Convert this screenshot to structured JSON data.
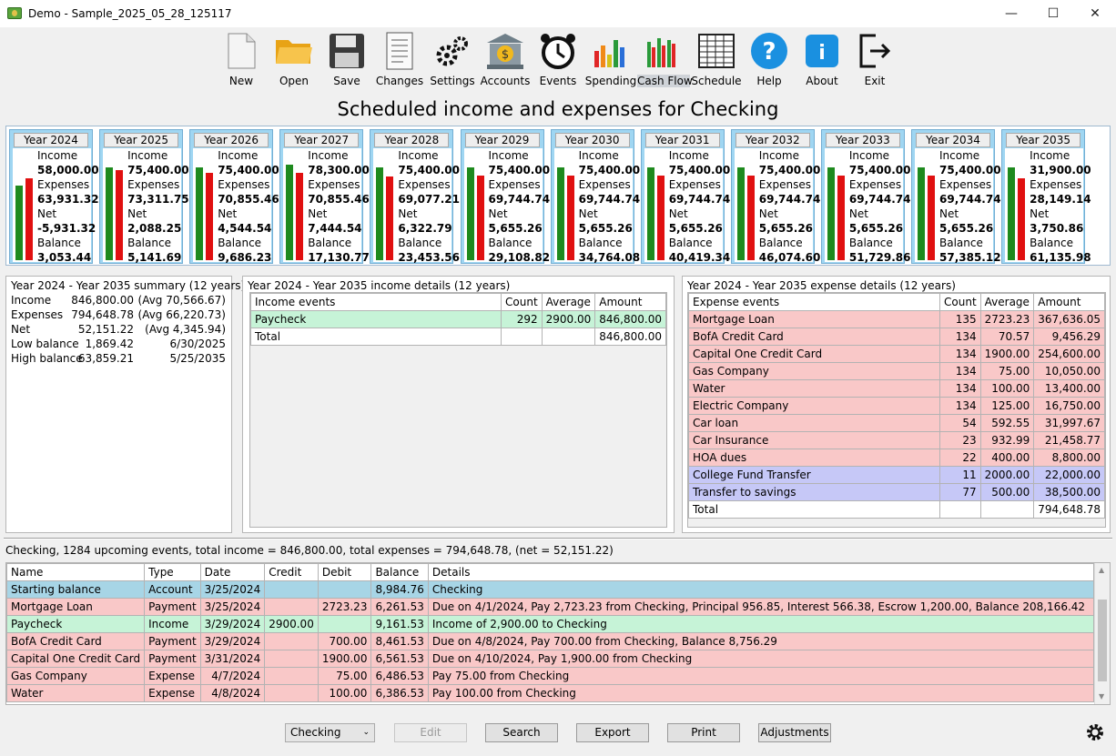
{
  "window": {
    "title": "Demo - Sample_2025_05_28_125117",
    "minimize": "—",
    "maximize": "☐",
    "close": "✕"
  },
  "toolbar": [
    {
      "label": "New",
      "icon": "new-file-icon"
    },
    {
      "label": "Open",
      "icon": "folder-open-icon"
    },
    {
      "label": "Save",
      "icon": "floppy-disk-icon"
    },
    {
      "label": "Changes",
      "icon": "document-changes-icon"
    },
    {
      "label": "Settings",
      "icon": "gears-icon"
    },
    {
      "label": "Accounts",
      "icon": "bank-icon"
    },
    {
      "label": "Events",
      "icon": "alarm-clock-icon"
    },
    {
      "label": "Spending",
      "icon": "bar-chart-icon"
    },
    {
      "label": "Cash Flow",
      "icon": "cash-flow-chart-icon"
    },
    {
      "label": "Schedule",
      "icon": "calendar-grid-icon"
    },
    {
      "label": "Help",
      "icon": "help-icon"
    },
    {
      "label": "About",
      "icon": "info-icon"
    },
    {
      "label": "Exit",
      "icon": "exit-icon"
    }
  ],
  "heading": "Scheduled income and expenses for Checking",
  "year_labels": {
    "income": "Income",
    "expenses": "Expenses",
    "net": "Net",
    "balance": "Balance"
  },
  "years": [
    {
      "year": "Year 2024",
      "income": "58,000.00",
      "expenses": "63,931.32",
      "net": "-5,931.32",
      "balance": "3,053.44",
      "income_fraction": 0.78,
      "expense_fraction": 0.86
    },
    {
      "year": "Year 2025",
      "income": "75,400.00",
      "expenses": "73,311.75",
      "net": "2,088.25",
      "balance": "5,141.69",
      "income_fraction": 0.97,
      "expense_fraction": 0.94
    },
    {
      "year": "Year 2026",
      "income": "75,400.00",
      "expenses": "70,855.46",
      "net": "4,544.54",
      "balance": "9,686.23",
      "income_fraction": 0.97,
      "expense_fraction": 0.91
    },
    {
      "year": "Year 2027",
      "income": "78,300.00",
      "expenses": "70,855.46",
      "net": "7,444.54",
      "balance": "17,130.77",
      "income_fraction": 1.0,
      "expense_fraction": 0.91
    },
    {
      "year": "Year 2028",
      "income": "75,400.00",
      "expenses": "69,077.21",
      "net": "6,322.79",
      "balance": "23,453.56",
      "income_fraction": 0.97,
      "expense_fraction": 0.88
    },
    {
      "year": "Year 2029",
      "income": "75,400.00",
      "expenses": "69,744.74",
      "net": "5,655.26",
      "balance": "29,108.82",
      "income_fraction": 0.97,
      "expense_fraction": 0.89
    },
    {
      "year": "Year 2030",
      "income": "75,400.00",
      "expenses": "69,744.74",
      "net": "5,655.26",
      "balance": "34,764.08",
      "income_fraction": 0.97,
      "expense_fraction": 0.89
    },
    {
      "year": "Year 2031",
      "income": "75,400.00",
      "expenses": "69,744.74",
      "net": "5,655.26",
      "balance": "40,419.34",
      "income_fraction": 0.97,
      "expense_fraction": 0.89
    },
    {
      "year": "Year 2032",
      "income": "75,400.00",
      "expenses": "69,744.74",
      "net": "5,655.26",
      "balance": "46,074.60",
      "income_fraction": 0.97,
      "expense_fraction": 0.89
    },
    {
      "year": "Year 2033",
      "income": "75,400.00",
      "expenses": "69,744.74",
      "net": "5,655.26",
      "balance": "51,729.86",
      "income_fraction": 0.97,
      "expense_fraction": 0.89
    },
    {
      "year": "Year 2034",
      "income": "75,400.00",
      "expenses": "69,744.74",
      "net": "5,655.26",
      "balance": "57,385.12",
      "income_fraction": 0.97,
      "expense_fraction": 0.89
    },
    {
      "year": "Year 2035",
      "income": "31,900.00",
      "expenses": "28,149.14",
      "net": "3,750.86",
      "balance": "61,135.98",
      "income_fraction": 0.97,
      "expense_fraction": 0.86
    }
  ],
  "summary": {
    "title": "Year 2024 - Year 2035 summary (12 years)",
    "rows": [
      {
        "label": "Income",
        "value": "846,800.00",
        "extra": "(Avg 70,566.67)"
      },
      {
        "label": "Expenses",
        "value": "794,648.78",
        "extra": "(Avg 66,220.73)"
      },
      {
        "label": "Net",
        "value": "52,151.22",
        "extra": "(Avg 4,345.94)"
      },
      {
        "label": "Low balance",
        "value": "1,869.42",
        "extra": "6/30/2025"
      },
      {
        "label": "High balance",
        "value": "63,859.21",
        "extra": "5/25/2035"
      }
    ]
  },
  "income_details": {
    "title": "Year 2024 - Year 2035 income details (12 years)",
    "headers": [
      "Income events",
      "Count",
      "Average",
      "Amount"
    ],
    "rows": [
      {
        "name": "Paycheck",
        "count": "292",
        "avg": "2900.00",
        "amount": "846,800.00"
      }
    ],
    "total_label": "Total",
    "total": "846,800.00"
  },
  "expense_details": {
    "title": "Year 2024 - Year 2035 expense details (12 years)",
    "headers": [
      "Expense events",
      "Count",
      "Average",
      "Amount"
    ],
    "rows": [
      {
        "name": "Mortgage Loan",
        "count": "135",
        "avg": "2723.23",
        "amount": "367,636.05",
        "kind": "pink"
      },
      {
        "name": "BofA Credit Card",
        "count": "134",
        "avg": "70.57",
        "amount": "9,456.29",
        "kind": "pink"
      },
      {
        "name": "Capital One Credit Card",
        "count": "134",
        "avg": "1900.00",
        "amount": "254,600.00",
        "kind": "pink"
      },
      {
        "name": "Gas Company",
        "count": "134",
        "avg": "75.00",
        "amount": "10,050.00",
        "kind": "pink"
      },
      {
        "name": "Water",
        "count": "134",
        "avg": "100.00",
        "amount": "13,400.00",
        "kind": "pink"
      },
      {
        "name": "Electric Company",
        "count": "134",
        "avg": "125.00",
        "amount": "16,750.00",
        "kind": "pink"
      },
      {
        "name": "Car loan",
        "count": "54",
        "avg": "592.55",
        "amount": "31,997.67",
        "kind": "pink"
      },
      {
        "name": "Car Insurance",
        "count": "23",
        "avg": "932.99",
        "amount": "21,458.77",
        "kind": "pink"
      },
      {
        "name": "HOA dues",
        "count": "22",
        "avg": "400.00",
        "amount": "8,800.00",
        "kind": "pink"
      },
      {
        "name": "College Fund Transfer",
        "count": "11",
        "avg": "2000.00",
        "amount": "22,000.00",
        "kind": "blue"
      },
      {
        "name": "Transfer to savings",
        "count": "77",
        "avg": "500.00",
        "amount": "38,500.00",
        "kind": "blue"
      }
    ],
    "total_label": "Total",
    "total": "794,648.78"
  },
  "status": "Checking, 1284 upcoming events, total income = 846,800.00, total expenses = 794,648.78, (net = 52,151.22)",
  "events": {
    "headers": [
      "Name",
      "Type",
      "Date",
      "Credit",
      "Debit",
      "Balance",
      "Details"
    ],
    "rows": [
      {
        "name": "Starting balance",
        "type": "Account",
        "date": "3/25/2024",
        "credit": "",
        "debit": "",
        "balance": "8,984.76",
        "details": "Checking",
        "kind": "acct"
      },
      {
        "name": "Mortgage Loan",
        "type": "Payment",
        "date": "3/25/2024",
        "credit": "",
        "debit": "2723.23",
        "balance": "6,261.53",
        "details": "Due on 4/1/2024, Pay 2,723.23 from Checking, Principal 956.85, Interest 566.38, Escrow 1,200.00, Balance 208,166.42",
        "kind": "pink"
      },
      {
        "name": "Paycheck",
        "type": "Income",
        "date": "3/29/2024",
        "credit": "2900.00",
        "debit": "",
        "balance": "9,161.53",
        "details": "Income of 2,900.00 to Checking",
        "kind": "green"
      },
      {
        "name": "BofA Credit Card",
        "type": "Payment",
        "date": "3/29/2024",
        "credit": "",
        "debit": "700.00",
        "balance": "8,461.53",
        "details": "Due on 4/8/2024, Pay 700.00 from Checking, Balance 8,756.29",
        "kind": "pink"
      },
      {
        "name": "Capital One Credit Card",
        "type": "Payment",
        "date": "3/31/2024",
        "credit": "",
        "debit": "1900.00",
        "balance": "6,561.53",
        "details": "Due on 4/10/2024, Pay 1,900.00 from Checking",
        "kind": "pink"
      },
      {
        "name": "Gas Company",
        "type": "Expense",
        "date": "4/7/2024",
        "credit": "",
        "debit": "75.00",
        "balance": "6,486.53",
        "details": "Pay 75.00 from Checking",
        "kind": "pink"
      },
      {
        "name": "Water",
        "type": "Expense",
        "date": "4/8/2024",
        "credit": "",
        "debit": "100.00",
        "balance": "6,386.53",
        "details": "Pay 100.00 from Checking",
        "kind": "pink"
      }
    ]
  },
  "footer": {
    "account_select": "Checking",
    "edit": "Edit",
    "search": "Search",
    "export": "Export",
    "print": "Print",
    "adjustments": "Adjustments",
    "settings_icon": "gear-icon"
  }
}
